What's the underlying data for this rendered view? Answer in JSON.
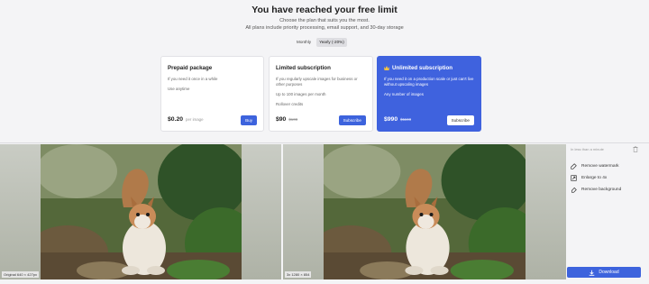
{
  "header": {
    "title": "You have reached your free limit",
    "subtitle": "Choose the plan that suits you the most.",
    "subtitle2": "All plans include priority processing, email support, and 30-day storage"
  },
  "billing_toggle": {
    "monthly": "Monthly",
    "yearly": "Yearly (-20%)"
  },
  "plans": [
    {
      "title": "Prepaid package",
      "desc": [
        "If you need it once in a while",
        "Use anytime"
      ],
      "price": "$0.20",
      "per": "per image",
      "button": "Buy"
    },
    {
      "title": "Limited subscription",
      "desc": [
        "If you regularly upscale images for business or other purposes",
        "Up to 100 images per month",
        "Rollover credits"
      ],
      "price": "$90",
      "old_price": "$108",
      "button": "Subscribe"
    },
    {
      "title": "Unlimited subscription",
      "desc": [
        "If you need it on a production scale or just can't live without upscaling images",
        "Any number of images"
      ],
      "price": "$990",
      "old_price": "$1188",
      "button": "Subscribe"
    }
  ],
  "preview": {
    "original_caption": "Original 640 × 427px",
    "result_caption": "3x 1280 × 854"
  },
  "sidebar": {
    "hint": "In less than a minute",
    "options": [
      "Remove watermark",
      "Enlarge to 4x",
      "Remove background"
    ],
    "download": "Download"
  },
  "colors": {
    "accent": "#3d63dd",
    "background": "#f4f4f6"
  }
}
